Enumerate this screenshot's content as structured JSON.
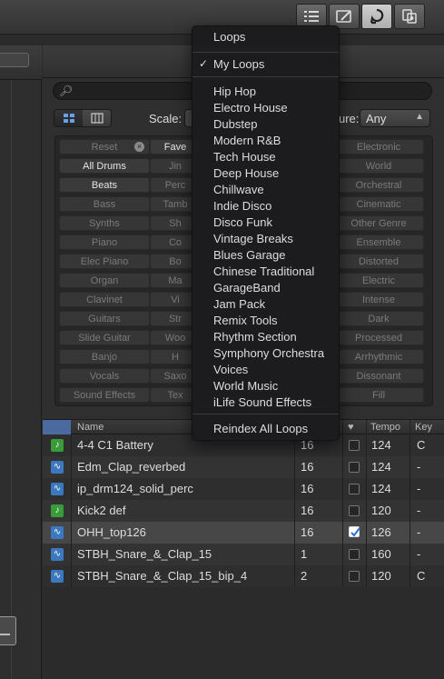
{
  "toolbar": {
    "icons": [
      "list-view-icon",
      "notepad-icon",
      "loop-browser-icon",
      "media-browser-icon"
    ]
  },
  "browser": {
    "scale_label": "Scale:",
    "signature_label": "ure:",
    "signature_value": "Any"
  },
  "keywords": [
    [
      "Reset",
      "Fave",
      "",
      "Electronic"
    ],
    [
      "All Drums",
      "Jin",
      "",
      "World"
    ],
    [
      "Beats",
      "Perc",
      "",
      "Orchestral"
    ],
    [
      "Bass",
      "Tamb",
      "",
      "Cinematic"
    ],
    [
      "Synths",
      "Sh",
      "",
      "Other Genre"
    ],
    [
      "Piano",
      "Co",
      "",
      "Ensemble"
    ],
    [
      "Elec Piano",
      "Bo",
      "",
      "Distorted"
    ],
    [
      "Organ",
      "Ma",
      "",
      "Electric"
    ],
    [
      "Clavinet",
      "Vi",
      "",
      "Intense"
    ],
    [
      "Guitars",
      "Str",
      "",
      "Dark"
    ],
    [
      "Slide Guitar",
      "Woo",
      "",
      "Processed"
    ],
    [
      "Banjo",
      "H",
      "",
      "Arrhythmic"
    ],
    [
      "Vocals",
      "Saxo",
      "",
      "Dissonant"
    ],
    [
      "Sound Effects",
      "Tex",
      "",
      "Fill"
    ]
  ],
  "table": {
    "headers": {
      "name": "Name",
      "fav": "♥",
      "tempo": "Tempo",
      "key": "Key"
    },
    "rows": [
      {
        "type": "green",
        "name": "4-4 C1 Battery",
        "beats": "16",
        "fav": false,
        "tempo": "124",
        "key": "C"
      },
      {
        "type": "blue",
        "name": "Edm_Clap_reverbed",
        "beats": "16",
        "fav": false,
        "tempo": "124",
        "key": "-"
      },
      {
        "type": "blue",
        "name": "ip_drm124_solid_perc",
        "beats": "16",
        "fav": false,
        "tempo": "124",
        "key": "-"
      },
      {
        "type": "green",
        "name": "Kick2 def",
        "beats": "16",
        "fav": false,
        "tempo": "120",
        "key": "-"
      },
      {
        "type": "blue",
        "name": "OHH_top126",
        "beats": "16",
        "fav": true,
        "tempo": "126",
        "key": "-"
      },
      {
        "type": "blue",
        "name": "STBH_Snare_&_Clap_15",
        "beats": "1",
        "fav": false,
        "tempo": "160",
        "key": "-"
      },
      {
        "type": "blue",
        "name": "STBH_Snare_&_Clap_15_bip_4",
        "beats": "2",
        "fav": false,
        "tempo": "120",
        "key": "C"
      }
    ]
  },
  "menu": {
    "header": "Loops",
    "checked_item": "My Loops",
    "items": [
      "Hip Hop",
      "Electro House",
      "Dubstep",
      "Modern R&B",
      "Tech House",
      "Deep House",
      "Chillwave",
      "Indie Disco",
      "Disco Funk",
      "Vintage Breaks",
      "Blues Garage",
      "Chinese Traditional",
      "GarageBand",
      "Jam Pack",
      "Remix Tools",
      "Rhythm Section",
      "Symphony Orchestra",
      "Voices",
      "World Music",
      "iLife Sound Effects"
    ],
    "footer": "Reindex All Loops"
  }
}
